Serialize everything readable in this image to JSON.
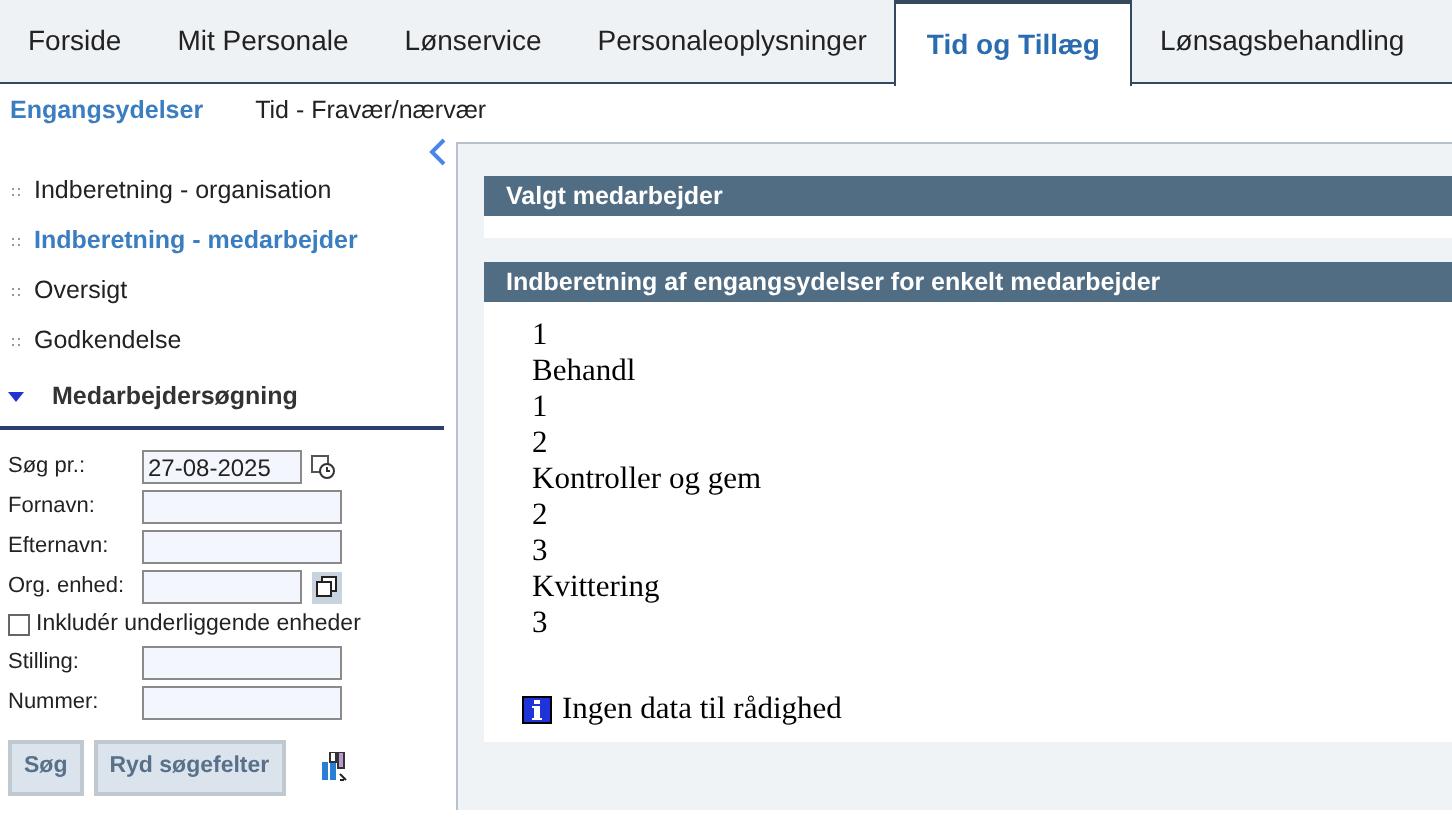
{
  "tabs": [
    {
      "label": "Forside",
      "selected": false
    },
    {
      "label": "Mit Personale",
      "selected": false
    },
    {
      "label": "Lønservice",
      "selected": false
    },
    {
      "label": "Personaleoplysninger",
      "selected": false
    },
    {
      "label": "Tid og Tillæg",
      "selected": true
    },
    {
      "label": "Lønsagsbehandling",
      "selected": false
    }
  ],
  "subnav": [
    {
      "label": "Engangsydelser",
      "selected": true
    },
    {
      "label": "Tid - Fravær/nærvær",
      "selected": false
    }
  ],
  "sidebar": {
    "items": [
      {
        "label": "Indberetning - organisation",
        "selected": false
      },
      {
        "label": "Indberetning - medarbejder",
        "selected": true
      },
      {
        "label": "Oversigt",
        "selected": false
      },
      {
        "label": "Godkendelse",
        "selected": false
      }
    ],
    "search": {
      "title": "Medarbejdersøgning",
      "expanded": true,
      "fields": [
        {
          "label": "Søg pr.:",
          "value": "27-08-2025",
          "kind": "date"
        },
        {
          "label": "Fornavn:",
          "kind": "text"
        },
        {
          "label": "Efternavn:",
          "kind": "text"
        },
        {
          "label": "Org. enhed:",
          "kind": "picker"
        },
        {
          "label": "Inkludér underliggende enheder",
          "kind": "checkbox",
          "checked": false
        },
        {
          "label": "Stilling:",
          "kind": "text"
        },
        {
          "label": "Nummer:",
          "kind": "text"
        }
      ],
      "buttons": [
        "Søg",
        "Ryd søgefelter"
      ]
    }
  },
  "panels": [
    {
      "title": "Valgt medarbejder"
    },
    {
      "title": "Indberetning af engangsydelser for enkelt medarbejder",
      "lines": [
        "1",
        "Behandl",
        "1",
        "2",
        "Kontroller og gem",
        "2",
        "3",
        "Kvittering",
        "3"
      ],
      "info": "Ingen data til rådighed"
    }
  ]
}
